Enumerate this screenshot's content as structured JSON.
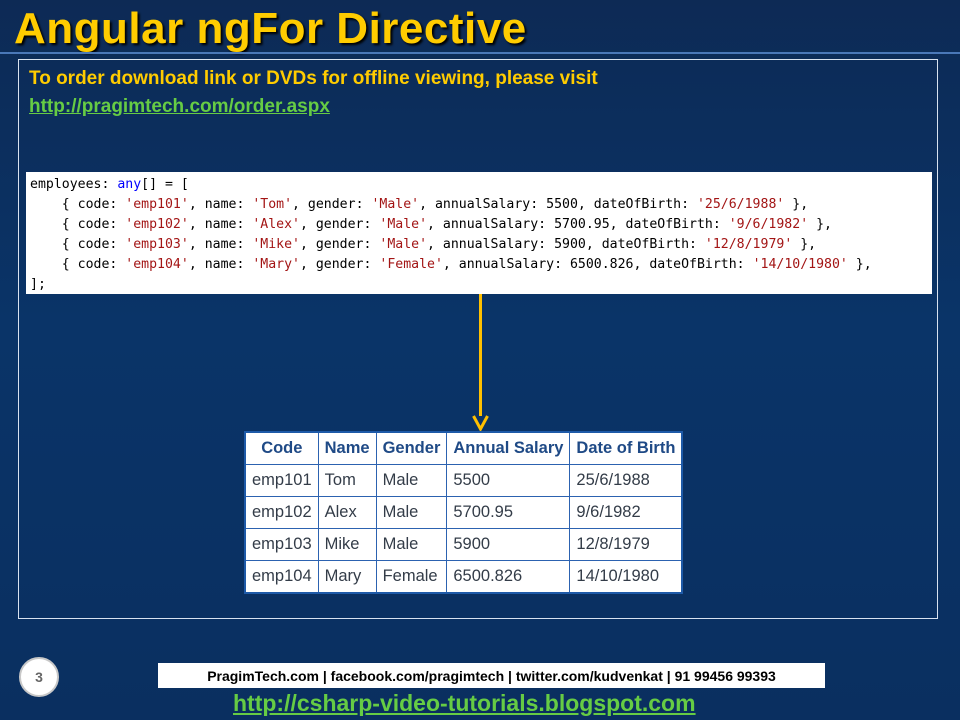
{
  "slide": {
    "title": "Angular ngFor Directive",
    "order_text": "To order download link or DVDs for offline viewing, please visit",
    "order_link": "http://pragimtech.com/order.aspx"
  },
  "code": {
    "lines": [
      [
        {
          "t": "employees: "
        },
        {
          "t": "any",
          "k": "kw"
        },
        {
          "t": "[] = ["
        }
      ],
      [
        {
          "t": "    { code: "
        },
        {
          "t": "'emp101'",
          "k": "str"
        },
        {
          "t": ", name: "
        },
        {
          "t": "'Tom'",
          "k": "str"
        },
        {
          "t": ", gender: "
        },
        {
          "t": "'Male'",
          "k": "str"
        },
        {
          "t": ", annualSalary: 5500, dateOfBirth: "
        },
        {
          "t": "'25/6/1988'",
          "k": "str"
        },
        {
          "t": " },"
        }
      ],
      [
        {
          "t": "    { code: "
        },
        {
          "t": "'emp102'",
          "k": "str"
        },
        {
          "t": ", name: "
        },
        {
          "t": "'Alex'",
          "k": "str"
        },
        {
          "t": ", gender: "
        },
        {
          "t": "'Male'",
          "k": "str"
        },
        {
          "t": ", annualSalary: 5700.95, dateOfBirth: "
        },
        {
          "t": "'9/6/1982'",
          "k": "str"
        },
        {
          "t": " },"
        }
      ],
      [
        {
          "t": "    { code: "
        },
        {
          "t": "'emp103'",
          "k": "str"
        },
        {
          "t": ", name: "
        },
        {
          "t": "'Mike'",
          "k": "str"
        },
        {
          "t": ", gender: "
        },
        {
          "t": "'Male'",
          "k": "str"
        },
        {
          "t": ", annualSalary: 5900, dateOfBirth: "
        },
        {
          "t": "'12/8/1979'",
          "k": "str"
        },
        {
          "t": " },"
        }
      ],
      [
        {
          "t": "    { code: "
        },
        {
          "t": "'emp104'",
          "k": "str"
        },
        {
          "t": ", name: "
        },
        {
          "t": "'Mary'",
          "k": "str"
        },
        {
          "t": ", gender: "
        },
        {
          "t": "'Female'",
          "k": "str"
        },
        {
          "t": ", annualSalary: 6500.826, dateOfBirth: "
        },
        {
          "t": "'14/10/1980'",
          "k": "str"
        },
        {
          "t": " },"
        }
      ],
      [
        {
          "t": "];"
        }
      ]
    ]
  },
  "table": {
    "headers": [
      "Code",
      "Name",
      "Gender",
      "Annual Salary",
      "Date of Birth"
    ],
    "rows": [
      [
        "emp101",
        "Tom",
        "Male",
        "5500",
        "25/6/1988"
      ],
      [
        "emp102",
        "Alex",
        "Male",
        "5700.95",
        "9/6/1982"
      ],
      [
        "emp103",
        "Mike",
        "Male",
        "5900",
        "12/8/1979"
      ],
      [
        "emp104",
        "Mary",
        "Female",
        "6500.826",
        "14/10/1980"
      ]
    ]
  },
  "footer": {
    "page_number": "3",
    "contact": "PragimTech.com | facebook.com/pragimtech  | twitter.com/kudvenkat  | 91 99456 99393",
    "blog_link": "http://csharp-video-tutorials.blogspot.com"
  },
  "colors": {
    "title": "#ffcc00",
    "link": "#66cc44",
    "arrow": "#ffc000",
    "table_border": "#1e5aa8"
  }
}
